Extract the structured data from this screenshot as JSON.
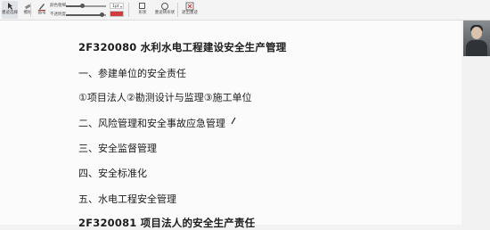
{
  "toolbar": {
    "select_label": "墨迹选择",
    "eraser_label": "擦除",
    "pen_label": "画笔",
    "pen_color_label": "颜色粗细",
    "opacity_label": "不透明度",
    "size_value": "1pt",
    "shape_select": "形状",
    "ink_to_shape_label": "墨迹转形状",
    "exit_label": "退出墨迹",
    "pen_color": "#d23c3c"
  },
  "document": {
    "heading1": "2F320080  水利水电工程建设安全生产管理",
    "item1": "一、参建单位的安全责任",
    "item1_detail": "①项目法人②勘测设计与监理③施工单位",
    "item2": "二、风险管理和安全事故应急管理",
    "item3": "三、安全监督管理",
    "item4": "四、安全标准化",
    "item5": "五、水电工程安全管理",
    "heading2": "2F320081  项目法人的安全生产责任"
  }
}
